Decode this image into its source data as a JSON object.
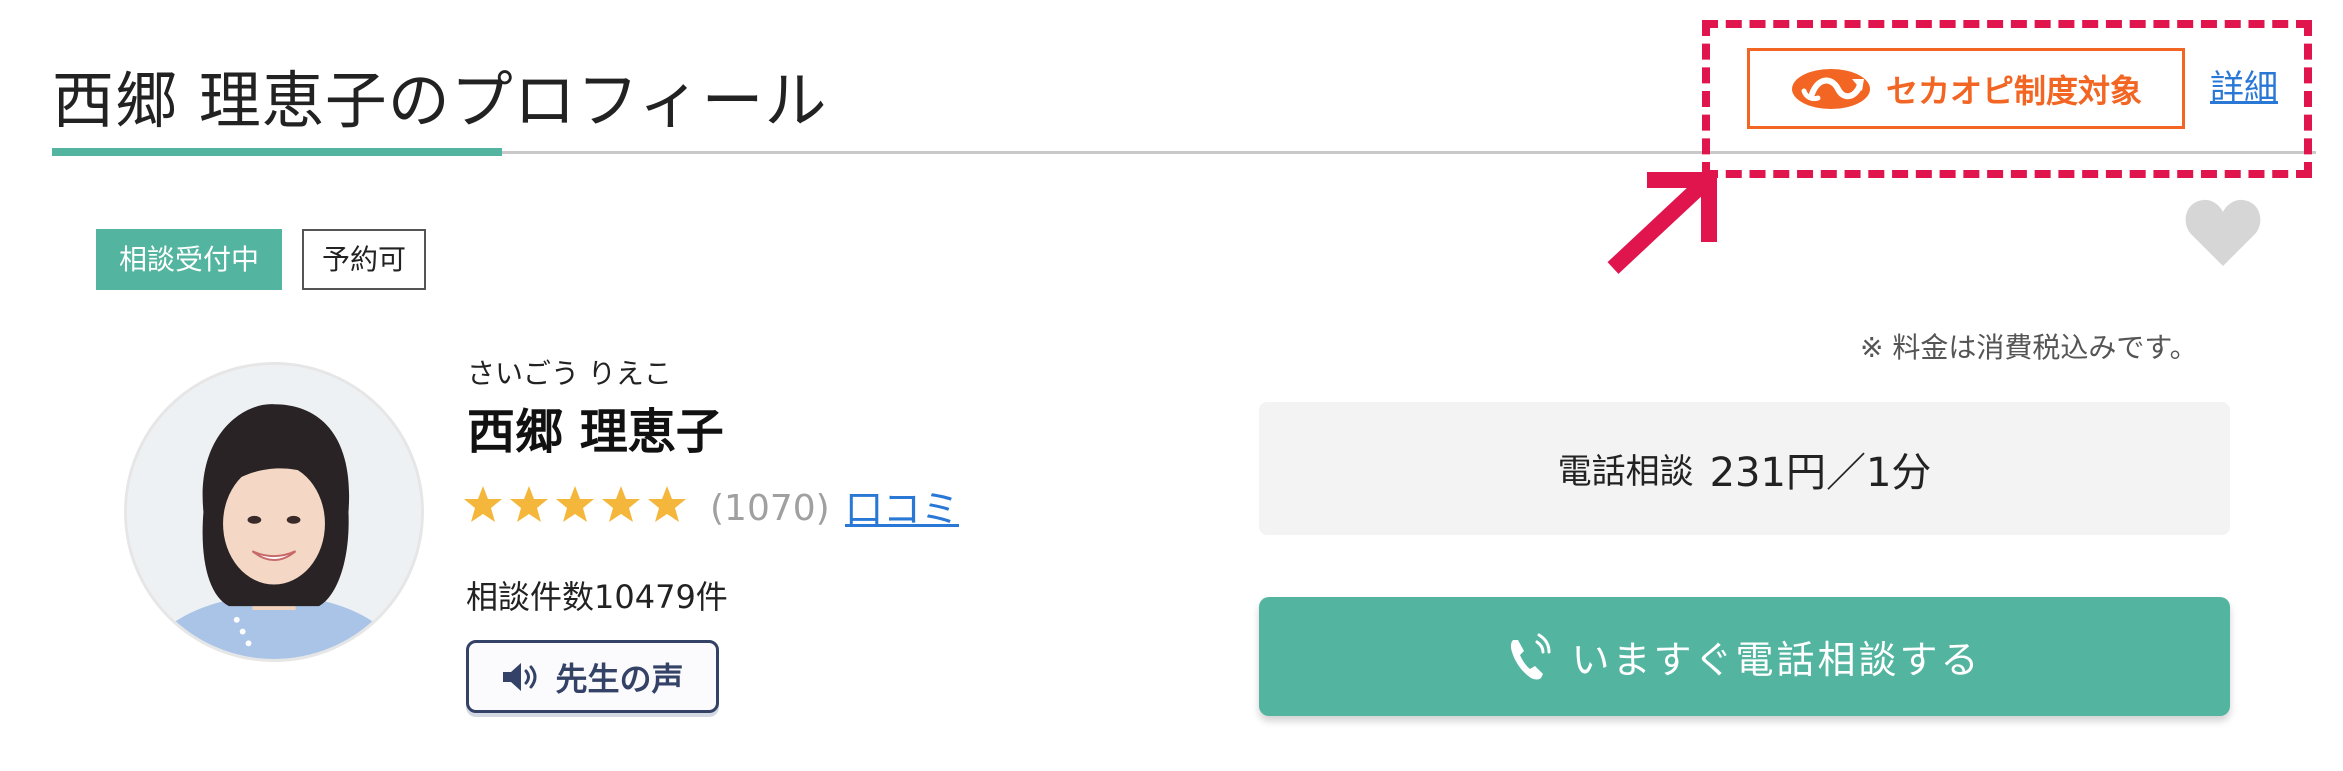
{
  "profile": {
    "title": "西郷 理恵子のプロフィール",
    "status_badge": "相談受付中",
    "reserve_badge": "予約可",
    "kana": "さいごう りえこ",
    "name": "西郷 理恵子",
    "rating_stars": 5,
    "review_count": "(1070)",
    "review_link": "口コミ",
    "consult_count": "相談件数10479件",
    "voice_button": "先生の声"
  },
  "sekaopi": {
    "badge_label": "セカオピ制度対象",
    "detail_link": "詳細"
  },
  "pricing": {
    "tax_note": "※ 料金は消費税込みです。",
    "label": "電話相談",
    "value": "231円／1分"
  },
  "cta": {
    "call_button": "いますぐ電話相談する"
  },
  "icons": {
    "sekaopi": "sekaopi-logo-icon",
    "heart": "heart-icon",
    "star": "star-icon",
    "speaker": "speaker-icon",
    "phone": "phone-icon",
    "arrow": "callout-arrow-icon"
  },
  "colors": {
    "accent_green": "#53b5a0",
    "orange": "#f26522",
    "callout_red": "#e0154e",
    "link_blue": "#2a78d6",
    "star_gold": "#f5b73b",
    "heart_gray": "#d6d6d6"
  }
}
